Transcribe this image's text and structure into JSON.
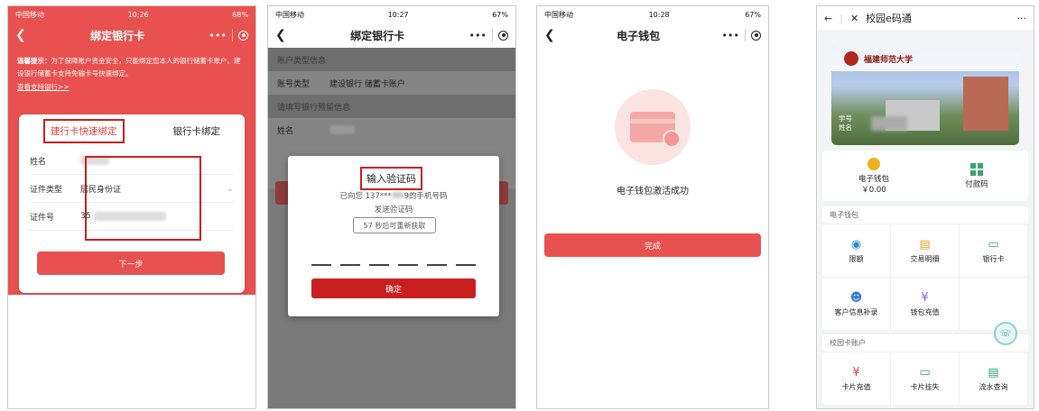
{
  "phone1": {
    "status": {
      "carrier": "中国移动",
      "time": "10:26",
      "battery": "68%"
    },
    "title": "绑定银行卡",
    "notice_bold": "温馨提示：",
    "notice_text": "为了保障账户资金安全，只能绑定您本人的银行储蓄卡账户。建设银行储蓄卡支持免输卡号快速绑定。",
    "notice_link": "查看支持银行>>",
    "tab_quick": "建行卡快速绑定",
    "tab_bank": "银行卡绑定",
    "name_label": "姓名",
    "id_type_label": "证件类型",
    "id_type_value": "居民身份证",
    "id_no_label": "证件号",
    "id_no_prefix": "35",
    "next_button": "下一步"
  },
  "phone2": {
    "status": {
      "carrier": "中国移动",
      "time": "10:27",
      "battery": "67%"
    },
    "title": "绑定银行卡",
    "account_type_header": "账户类型信息",
    "account_type_label": "账号类型",
    "account_type_value": "建设银行 储蓄卡账户",
    "reserved_info_header": "请填写银行预留信息",
    "name_label": "姓名",
    "dialog_title": "输入验证码",
    "dialog_sent_line1_a": "已向您 137***",
    "dialog_sent_line1_b": "9的手机号码",
    "dialog_sent_line2": "发送验证码",
    "resend_text": "57 秒后可重新获取",
    "confirm_button": "确定"
  },
  "phone3": {
    "status": {
      "carrier": "中国移动",
      "time": "10:28",
      "battery": "67%"
    },
    "title": "电子钱包",
    "success_message": "电子钱包激活成功",
    "done_button": "完成"
  },
  "phone4": {
    "title": "校园e码通",
    "more": "···",
    "university_name": "福建师范大学",
    "card_info_student_no": "学号",
    "card_info_name": "姓名",
    "wallet_label": "电子钱包",
    "wallet_balance": "￥0.00",
    "pay_code_label": "付款码",
    "section_wallet": "电子钱包",
    "wallet_items": [
      "限额",
      "交易明细",
      "银行卡",
      "客户信息补录",
      "钱包充值"
    ],
    "section_campus": "校园卡账户",
    "campus_items": [
      "卡片充值",
      "卡片挂失",
      "流水查询"
    ]
  }
}
